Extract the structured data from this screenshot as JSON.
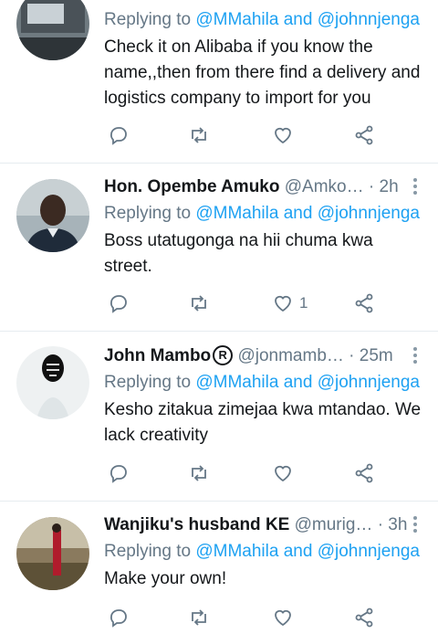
{
  "tweets": [
    {
      "name": "",
      "handle": "",
      "time": "",
      "replying_prefix": "Replying to ",
      "mention1": "@MMahila",
      "and": " and ",
      "mention2": "@johnnjenga",
      "text": "Check it on Alibaba if you know the name,,then from there find a delivery and logistics company to import for you",
      "likes": ""
    },
    {
      "name": "Hon. Opembe Amuko",
      "handle": "@Amko…",
      "time": "· 2h",
      "replying_prefix": "Replying to ",
      "mention1": "@MMahila",
      "and": " and ",
      "mention2": "@johnnjenga",
      "text": "Boss utatugonga na hii chuma kwa street.",
      "likes": "1"
    },
    {
      "name": "John Mambo",
      "handle": "@jonmamb…",
      "time": "· 25m",
      "replying_prefix": "Replying to ",
      "mention1": "@MMahila",
      "and": " and ",
      "mention2": "@johnnjenga",
      "text": "Kesho zitakua zimejaa kwa mtandao. We lack creativity",
      "likes": ""
    },
    {
      "name": "Wanjiku's husband KE",
      "handle": "@murig…",
      "time": "· 3h",
      "replying_prefix": "Replying to ",
      "mention1": "@MMahila",
      "and": " and ",
      "mention2": "@johnnjenga",
      "text": "Make your own!",
      "likes": ""
    }
  ],
  "registered_mark": "R",
  "colors": {
    "link": "#1da1f2",
    "muted": "#657786",
    "text": "#14171a",
    "divider": "#e6ecf0"
  },
  "icons": [
    "reply-icon",
    "retweet-icon",
    "heart-icon",
    "share-icon",
    "more-icon"
  ]
}
